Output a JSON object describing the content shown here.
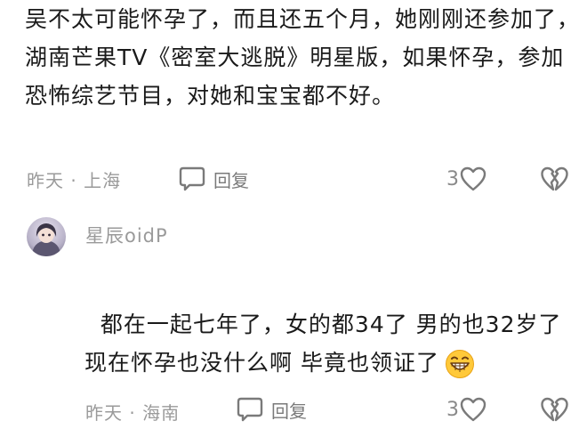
{
  "comments": [
    {
      "text": "吴不太可能怀孕了，而且还五个月，她刚刚还参加了，湖南芒果TV《密室大逃脱》明星版，如果怀孕，参加恐怖综艺节目，对她和宝宝都不好。",
      "meta": "昨天 · 上海",
      "reply_label": "回复",
      "like_count": "3"
    },
    {
      "username": "星辰oidP",
      "text": "都在一起七年了，女的都34了 男的也32岁了 现在怀孕也没什么啊 毕竟也领证了",
      "emoji": "grinning-face-emoji",
      "meta": "昨天 · 海南",
      "reply_label": "回复",
      "like_count": "3"
    }
  ],
  "colors": {
    "text": "#1a1a1a",
    "meta": "#9a9a9a",
    "icon": "#7a7a7a"
  }
}
